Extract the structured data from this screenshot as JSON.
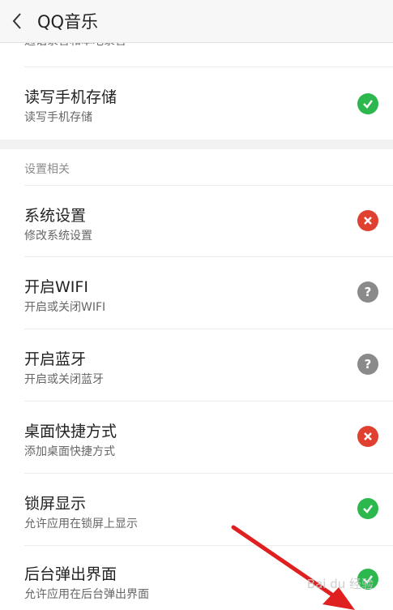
{
  "header": {
    "title": "QQ音乐"
  },
  "top_clipped_subtitle": "通话录音和本地录音",
  "top_item": {
    "title": "读写手机存储",
    "subtitle": "读写手机存储",
    "status_icon": "check-icon",
    "status_color": "#2db84d"
  },
  "section": {
    "label": "设置相关",
    "items": [
      {
        "title": "系统设置",
        "subtitle": "修改系统设置",
        "status": "denied",
        "icon": "cross-icon",
        "color": "#e0402f"
      },
      {
        "title": "开启WIFI",
        "subtitle": "开启或关闭WIFI",
        "status": "ask",
        "icon": "question-icon",
        "color": "#8a8a8a"
      },
      {
        "title": "开启蓝牙",
        "subtitle": "开启或关闭蓝牙",
        "status": "ask",
        "icon": "question-icon",
        "color": "#8a8a8a"
      },
      {
        "title": "桌面快捷方式",
        "subtitle": "添加桌面快捷方式",
        "status": "denied",
        "icon": "cross-icon",
        "color": "#e0402f"
      },
      {
        "title": "锁屏显示",
        "subtitle": "允许应用在锁屏上显示",
        "status": "allowed",
        "icon": "check-icon",
        "color": "#2db84d"
      },
      {
        "title": "后台弹出界面",
        "subtitle": "允许应用在后台弹出界面",
        "status": "allowed",
        "icon": "check-icon",
        "color": "#2db84d"
      }
    ]
  },
  "annotation": {
    "arrow_color": "#e02020"
  },
  "watermark": "Bai du 经验"
}
